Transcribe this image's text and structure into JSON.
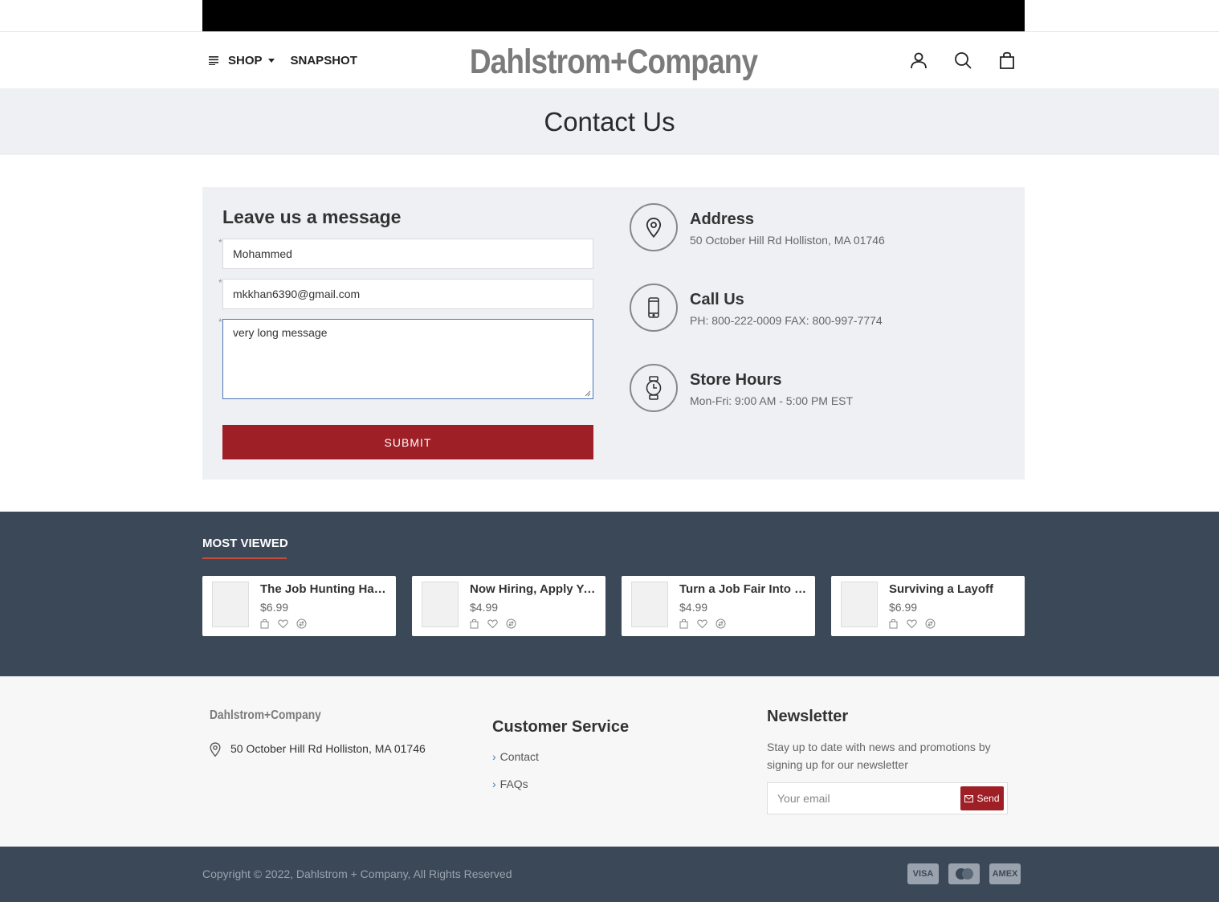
{
  "header": {
    "shop_label": "SHOP",
    "snapshot_label": "SNAPSHOT",
    "logo_text": "Dahlstrom+Company",
    "icons": [
      "user-icon",
      "search-icon",
      "cart-icon"
    ]
  },
  "page_title": "Contact Us",
  "form": {
    "title": "Leave us a message",
    "required_marker": "*",
    "name_value": "Mohammed",
    "email_value": "mkkhan6390@gmail.com",
    "message_value": "very long message",
    "submit_label": "SUBMIT"
  },
  "info": {
    "address_title": "Address",
    "address_text": "50 October Hill Rd Holliston, MA 01746",
    "call_title": "Call Us",
    "call_text": "PH: 800-222-0009 FAX: 800-997-7774",
    "hours_title": "Store Hours",
    "hours_text": "Mon-Fri: 9:00 AM - 5:00 PM EST"
  },
  "most_viewed": {
    "title": "MOST VIEWED",
    "products": [
      {
        "name": "The Job Hunting Handbook",
        "price": "$6.99"
      },
      {
        "name": "Now Hiring, Apply Yourself!",
        "price": "$4.99"
      },
      {
        "name": "Turn a Job Fair Into a Job Offer",
        "price": "$4.99"
      },
      {
        "name": "Surviving a Layoff",
        "price": "$6.99"
      }
    ]
  },
  "footer": {
    "logo_text": "Dahlstrom+Company",
    "address": "50 October Hill Rd Holliston, MA 01746",
    "customer_service_title": "Customer Service",
    "links": [
      "Contact",
      "FAQs"
    ],
    "newsletter_title": "Newsletter",
    "newsletter_text": "Stay up to date with news and promotions by signing up for our newsletter",
    "email_placeholder": "Your email",
    "send_label": "Send"
  },
  "bottom": {
    "copyright": "Copyright © 2022, Dahlstrom + Company, All Rights Reserved",
    "payment_icons": [
      "visa-icon",
      "mastercard-icon",
      "amex-icon"
    ],
    "visa_label": "VISA",
    "amex_label": "AMEX"
  },
  "colors": {
    "brand_red": "#9f1f26",
    "dark_slate": "#3b4857",
    "panel_gray": "#eef0f4"
  }
}
